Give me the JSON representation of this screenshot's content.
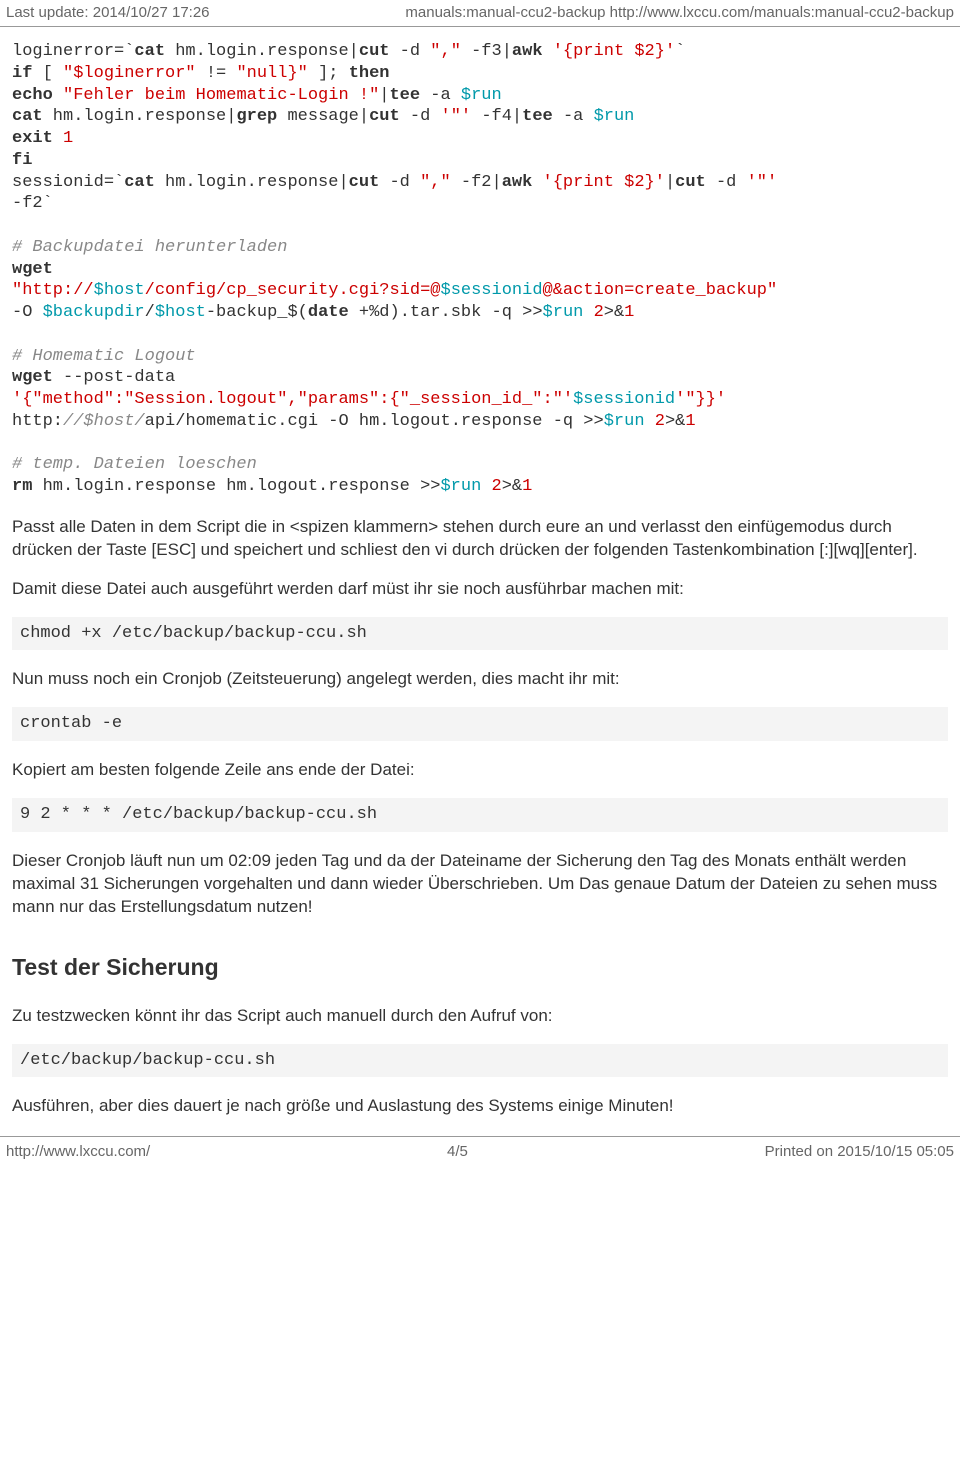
{
  "header": {
    "left": "Last update: 2014/10/27 17:26",
    "right": "manuals:manual-ccu2-backup http://www.lxccu.com/manuals:manual-ccu2-backup"
  },
  "p1": "Passt alle Daten in dem Script die in <spizen klammern> stehen durch eure an und verlasst den einfügemodus durch drücken der Taste [ESC] und speichert und schliest den vi durch drücken der folgenden Tastenkombination [:][wq][enter].",
  "p2": "Damit diese Datei auch ausgeführt werden darf müst ihr sie noch ausführbar machen mit:",
  "cmd_chmod": "chmod +x /etc/backup/backup-ccu.sh",
  "p3": "Nun muss noch ein Cronjob (Zeitsteuerung) angelegt werden, dies macht ihr mit:",
  "cmd_crontab": "crontab -e",
  "p4": "Kopiert am besten folgende Zeile ans ende der Datei:",
  "cmd_cronline": "9 2 * * * /etc/backup/backup-ccu.sh",
  "p5": "Dieser Cronjob läuft nun um 02:09 jeden Tag und da der Dateiname der Sicherung den Tag des Monats enthält werden maximal 31 Sicherungen vorgehalten und dann wieder Überschrieben. Um Das genaue Datum der Dateien zu sehen muss mann nur das Erstellungsdatum nutzen!",
  "h2": "Test der Sicherung",
  "p6": "Zu testzwecken könnt ihr das Script auch manuell durch den Aufruf von:",
  "cmd_run": "/etc/backup/backup-ccu.sh",
  "p7": "Ausführen, aber dies dauert je nach größe und Auslastung des Systems einige Minuten!",
  "footer": {
    "left": "http://www.lxccu.com/",
    "center": "4/5",
    "right": "Printed on 2015/10/15 05:05"
  },
  "script": {
    "l1_a": "loginerror=`",
    "l1_b": "cat",
    "l1_c": " hm.login.response|",
    "l1_d": "cut",
    "l1_e": " -d ",
    "l1_f": "\",\"",
    "l1_g": " -f3|",
    "l1_h": "awk",
    "l1_i": " ",
    "l1_j": "'{print $2}'",
    "l1_k": "`",
    "l2_a": "if",
    "l2_b": " [ ",
    "l2_c": "\"$loginerror\"",
    "l2_d": " != ",
    "l2_e": "\"null}\"",
    "l2_f": " ]; ",
    "l2_g": "then",
    "l3_a": "echo",
    "l3_b": " ",
    "l3_c": "\"Fehler beim Homematic-Login !\"",
    "l3_d": "|",
    "l3_e": "tee",
    "l3_f": " -a ",
    "l3_g": "$run",
    "l4_a": "cat",
    "l4_b": " hm.login.response|",
    "l4_c": "grep",
    "l4_d": " message|",
    "l4_e": "cut",
    "l4_f": " -d ",
    "l4_g": "'\"'",
    "l4_h": " -f4|",
    "l4_i": "tee",
    "l4_j": " -a ",
    "l4_k": "$run",
    "l5_a": "exit",
    "l5_b": " ",
    "l5_c": "1",
    "l6_a": "fi",
    "l7_a": "sessionid=`",
    "l7_b": "cat",
    "l7_c": " hm.login.response|",
    "l7_d": "cut",
    "l7_e": " -d ",
    "l7_f": "\",\"",
    "l7_g": " -f2|",
    "l7_h": "awk",
    "l7_i": " ",
    "l7_j": "'{print $2}'",
    "l7_k": "|",
    "l7_l": "cut",
    "l7_m": " -d ",
    "l7_n": "'\"'",
    "l8_a": "-f2`",
    "c1": "# Backupdatei herunterladen",
    "l10_a": "wget",
    "l11_a": "\"http://",
    "l11_b": "$host",
    "l11_c": "/config/cp_security.cgi?sid=@",
    "l11_d": "$sessionid",
    "l11_e": "@&action=create_backup\"",
    "l12_a": "-O ",
    "l12_b": "$backupdir",
    "l12_c": "/",
    "l12_d": "$host",
    "l12_e": "-backup_$(",
    "l12_f": "date",
    "l12_g": " +%d).tar.sbk -q >>",
    "l12_h": "$run",
    "l12_i": " ",
    "l12_j": "2",
    "l12_k": ">&",
    "l12_l": "1",
    "c2": "# Homematic Logout",
    "l14_a": "wget",
    "l14_b": " --post-data",
    "l15_a": "'{\"method\":\"Session.logout\",\"params\":{\"_session_id_\":\"'",
    "l15_b": "$sessionid",
    "l15_c": "'\"}}'",
    "l16_a": "http:",
    "l16_b": "//$host/",
    "l16_c": "api/homematic.cgi -O hm.logout.response -q >>",
    "l16_d": "$run",
    "l16_e": " ",
    "l16_f": "2",
    "l16_g": ">&",
    "l16_h": "1",
    "c3": "# temp. Dateien loeschen",
    "l18_a": "rm",
    "l18_b": " hm.login.response hm.logout.response >>",
    "l18_c": "$run",
    "l18_d": " ",
    "l18_e": "2",
    "l18_f": ">&",
    "l18_g": "1"
  }
}
